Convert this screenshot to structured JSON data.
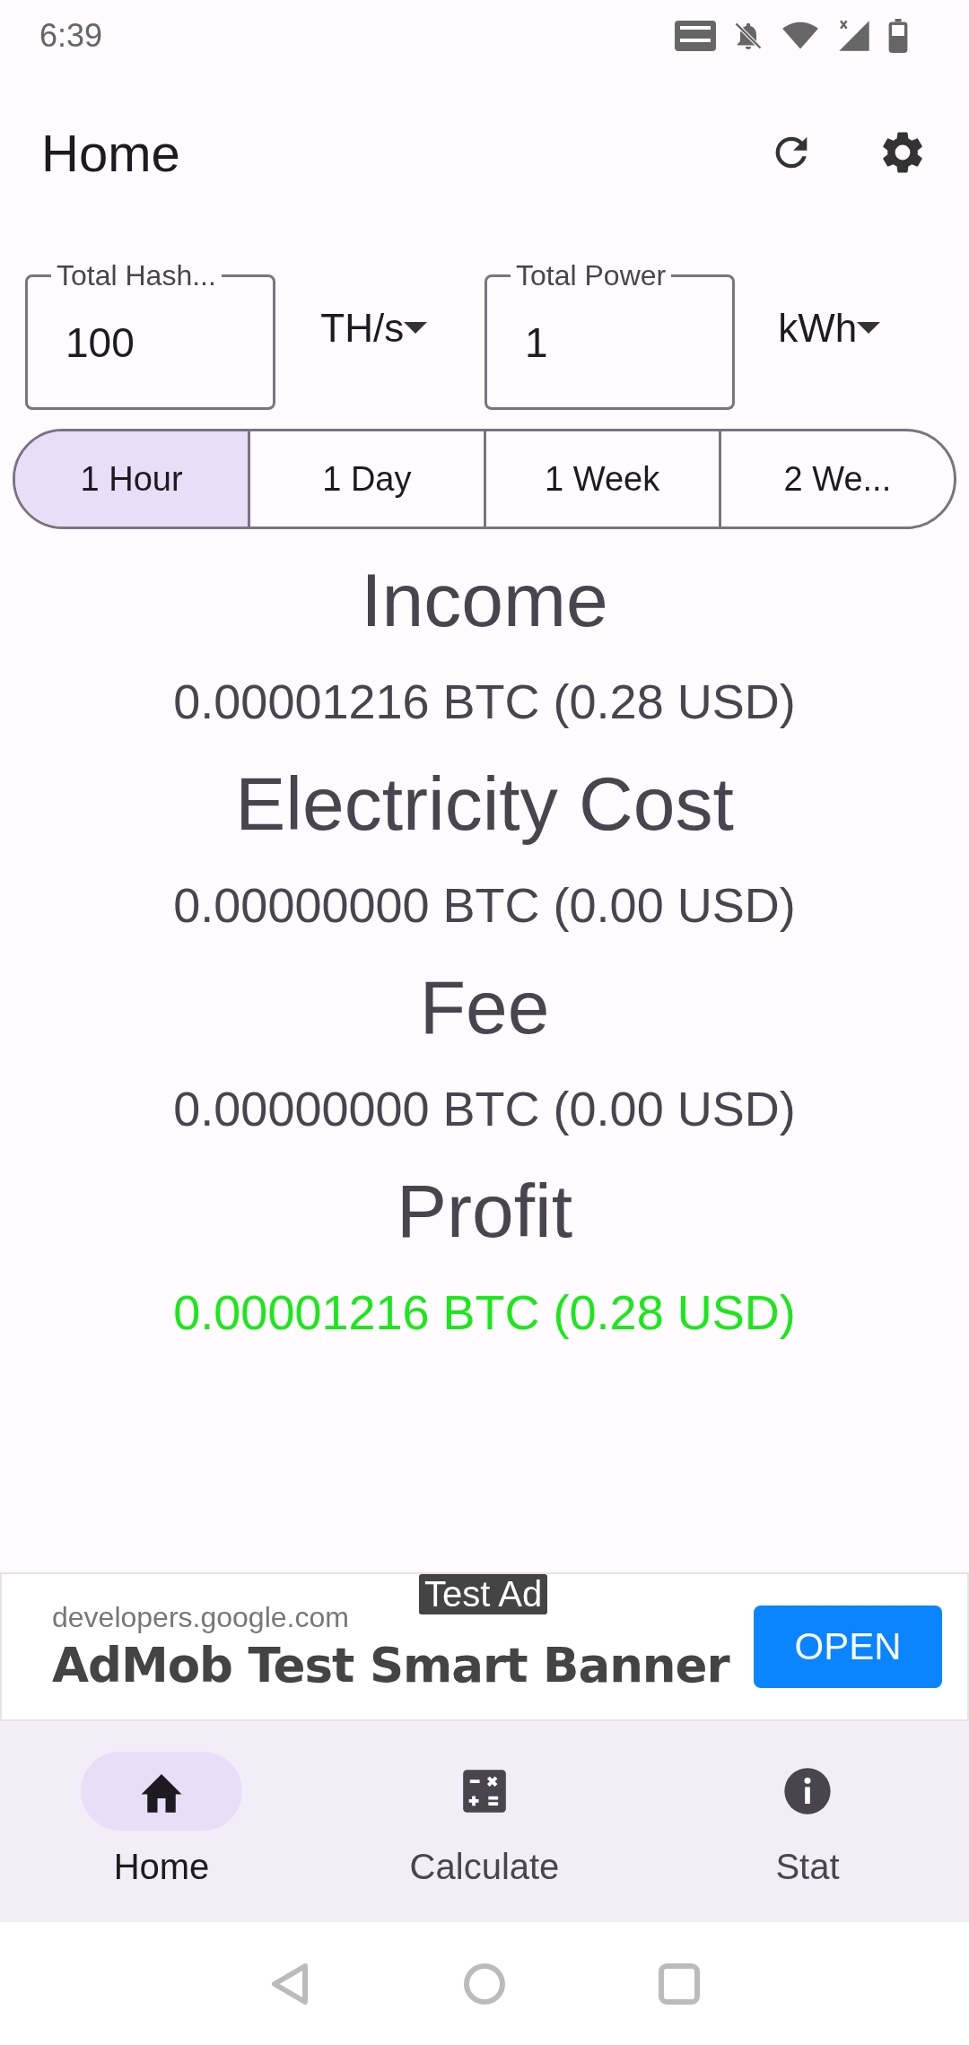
{
  "status_bar": {
    "time": "6:39"
  },
  "app_bar": {
    "title": "Home"
  },
  "inputs": [
    {
      "label": "Total Hash...",
      "value": "100",
      "unit": "TH/s"
    },
    {
      "label": "Total Power",
      "value": "1",
      "unit": "kWh"
    }
  ],
  "periods": [
    {
      "label": "1 Hour",
      "selected": true
    },
    {
      "label": "1 Day",
      "selected": false
    },
    {
      "label": "1 Week",
      "selected": false
    },
    {
      "label": "2 We...",
      "selected": false
    }
  ],
  "results": [
    {
      "title": "Income",
      "value": "0.00001216 BTC (0.28 USD)",
      "positive": false
    },
    {
      "title": "Electricity Cost",
      "value": "0.00000000 BTC (0.00 USD)",
      "positive": false
    },
    {
      "title": "Fee",
      "value": "0.00000000 BTC (0.00 USD)",
      "positive": false
    },
    {
      "title": "Profit",
      "value": "0.00001216 BTC (0.28 USD)",
      "positive": true
    }
  ],
  "ad": {
    "badge": "Test Ad",
    "domain": "developers.google.com",
    "headline": "AdMob Test Smart Banner",
    "button": "OPEN"
  },
  "bottom_nav": [
    {
      "label": "Home",
      "kind": "home",
      "selected": true
    },
    {
      "label": "Calculate",
      "kind": "calculator",
      "selected": false
    },
    {
      "label": "Stat",
      "kind": "info",
      "selected": false
    }
  ]
}
